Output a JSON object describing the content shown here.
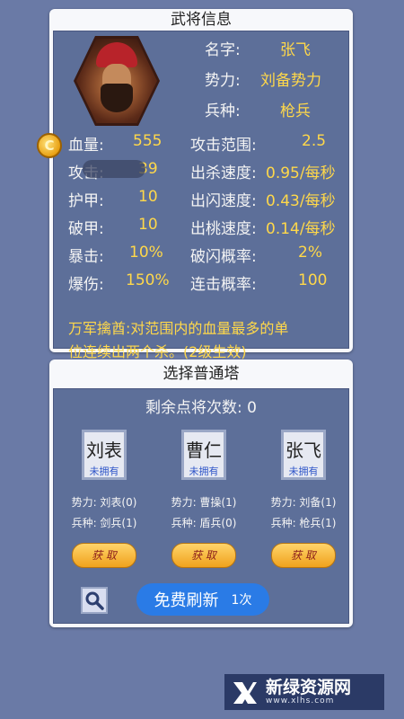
{
  "hero_panel": {
    "title": "武将信息",
    "info": [
      {
        "label": "名字:",
        "value": "张飞"
      },
      {
        "label": "势力:",
        "value": "刘备势力"
      },
      {
        "label": "兵种:",
        "value": "枪兵"
      }
    ],
    "stats_left": [
      {
        "label": "血量:",
        "value": "555"
      },
      {
        "label": "攻击:",
        "value": "39"
      },
      {
        "label": "护甲:",
        "value": "10"
      },
      {
        "label": "破甲:",
        "value": "10"
      },
      {
        "label": "暴击:",
        "value": "10%"
      },
      {
        "label": "爆伤:",
        "value": "150%"
      }
    ],
    "stats_right": [
      {
        "label": "攻击范围:",
        "value": "2.5"
      },
      {
        "label": "出杀速度:",
        "value": "0.95/每秒"
      },
      {
        "label": "出闪速度:",
        "value": "0.43/每秒"
      },
      {
        "label": "出桃速度:",
        "value": "0.14/每秒"
      },
      {
        "label": "破闪概率:",
        "value": "2%"
      },
      {
        "label": "连击概率:",
        "value": "100"
      }
    ],
    "skill_line1": "万军擒酋:对范围内的血量最多的单",
    "skill_line2": "位连续出两个杀。(2级生效)",
    "coin_letter": "C"
  },
  "tower_panel": {
    "title": "选择普通塔",
    "points_label": "剩余点将次数:",
    "points_value": "0",
    "cards": [
      {
        "name": "刘表",
        "status": "未拥有",
        "faction": "势力: 刘表(0)",
        "unit": "兵种: 剑兵(1)",
        "button": "获 取"
      },
      {
        "name": "曹仁",
        "status": "未拥有",
        "faction": "势力: 曹操(1)",
        "unit": "兵种: 盾兵(0)",
        "button": "获 取"
      },
      {
        "name": "张飞",
        "status": "未拥有",
        "faction": "势力: 刘备(1)",
        "unit": "兵种: 枪兵(1)",
        "button": "获 取"
      }
    ],
    "refresh_label": "免费刷新",
    "refresh_count": "1次"
  },
  "watermark": {
    "text": "新绿资源网",
    "url": "www.xlhs.com"
  },
  "colors": {
    "background": "#6a7aa6",
    "inner_panel": "#5d6f99",
    "value_yellow": "#ffd84a",
    "get_button": "#f0a21c",
    "refresh_button": "#2a7be6"
  }
}
